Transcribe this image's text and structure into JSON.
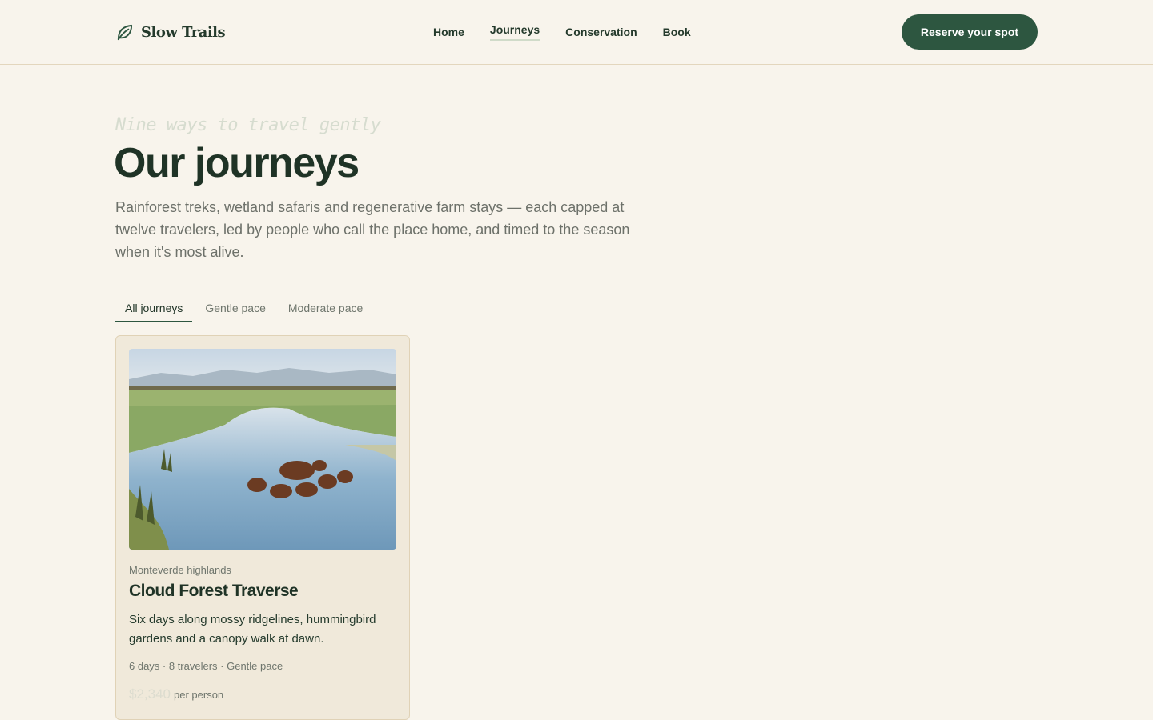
{
  "header": {
    "brand_name": "Slow Trails",
    "brand_icon": "leaf-icon",
    "nav": [
      {
        "label": "Home",
        "active": false
      },
      {
        "label": "Journeys",
        "active": true
      },
      {
        "label": "Conservation",
        "active": false
      },
      {
        "label": "Book",
        "active": false
      }
    ],
    "cta_label": "Reserve your spot"
  },
  "hero": {
    "eyebrow": "Nine ways to travel gently",
    "title": "Our journeys",
    "lead": "Rainforest treks, wetland safaris and regenerative farm stays — each capped at twelve travelers, led by people who call the place home, and timed to the season when it's most alive."
  },
  "filters": {
    "tabs": [
      {
        "label": "All journeys",
        "active": true
      },
      {
        "label": "Gentle pace",
        "active": false
      },
      {
        "label": "Moderate pace",
        "active": false
      }
    ]
  },
  "journeys": [
    {
      "region": "Monteverde highlands",
      "title": "Cloud Forest Traverse",
      "description": "Six days along mossy ridgelines, hummingbird gardens and a canopy walk at dawn.",
      "meta": "6 days · 8 travelers · Gentle pace",
      "price": "$2,340",
      "price_unit": "per person"
    }
  ],
  "colors": {
    "background": "#f8f4ec",
    "accent": "#2d5640",
    "card": "#f0e9da",
    "heading": "#1f3326"
  }
}
